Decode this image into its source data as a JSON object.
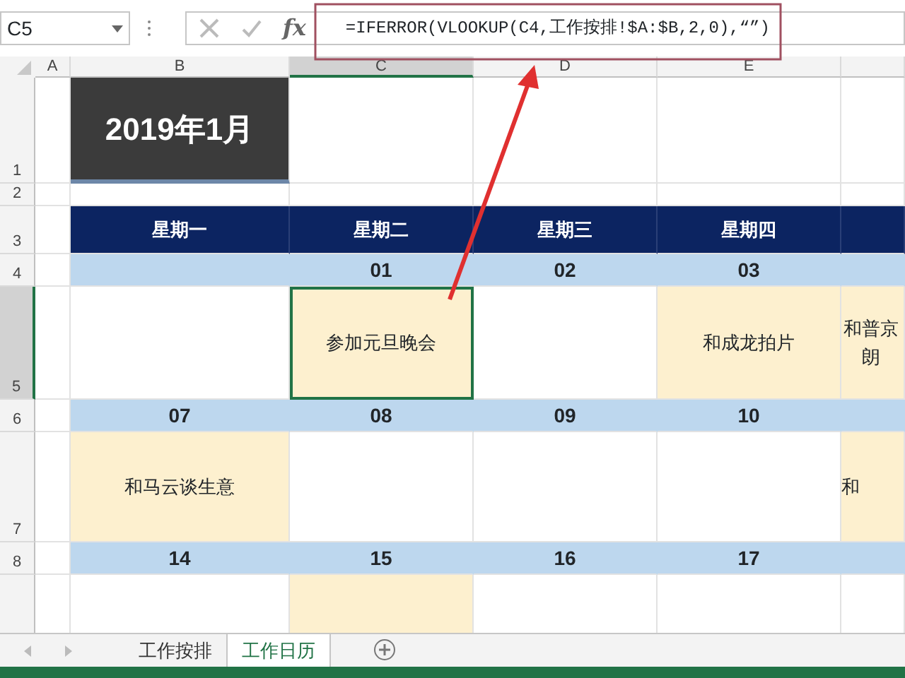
{
  "formula_bar": {
    "name_box": "C5",
    "function_label": "fx",
    "formula": "=IFERROR(VLOOKUP(C4,工作按排!$A:$B,2,0),“”)"
  },
  "columns": [
    {
      "label": "A",
      "selected": false
    },
    {
      "label": "B",
      "selected": false
    },
    {
      "label": "C",
      "selected": true
    },
    {
      "label": "D",
      "selected": false
    },
    {
      "label": "E",
      "selected": false
    }
  ],
  "rows": [
    {
      "label": "1",
      "selected": false
    },
    {
      "label": "2",
      "selected": false
    },
    {
      "label": "3",
      "selected": false
    },
    {
      "label": "4",
      "selected": false
    },
    {
      "label": "5",
      "selected": true
    },
    {
      "label": "6",
      "selected": false
    },
    {
      "label": "7",
      "selected": false
    },
    {
      "label": "8",
      "selected": false
    }
  ],
  "title": "2019年1月",
  "weekdays": [
    "星期一",
    "星期二",
    "星期三",
    "星期四"
  ],
  "weeks": [
    {
      "days": [
        {
          "highlighted": false,
          "selected": false
        },
        {
          "date": "01",
          "event": "参加元旦晚会",
          "highlighted": true,
          "selected": true
        },
        {
          "date": "02",
          "highlighted": false,
          "selected": false
        },
        {
          "date": "03",
          "event": "和成龙拍片",
          "highlighted": true,
          "selected": false
        },
        {
          "event": "和普京朗",
          "highlighted": true,
          "selected": false
        }
      ]
    },
    {
      "days": [
        {
          "date": "07",
          "event": "和马云谈生意",
          "highlighted": true,
          "selected": false
        },
        {
          "date": "08",
          "highlighted": false,
          "selected": false
        },
        {
          "date": "09",
          "highlighted": false,
          "selected": false
        },
        {
          "date": "10",
          "highlighted": false,
          "selected": false
        },
        {
          "event": "和",
          "highlighted": true,
          "selected": false
        }
      ]
    },
    {
      "days": [
        {
          "date": "14",
          "highlighted": false,
          "selected": false
        },
        {
          "date": "15",
          "highlighted": true,
          "selected": false
        },
        {
          "date": "16",
          "highlighted": false,
          "selected": false
        },
        {
          "date": "17",
          "highlighted": false,
          "selected": false
        },
        {
          "highlighted": false,
          "selected": false
        }
      ]
    }
  ],
  "sheet_tabs": [
    {
      "label": "工作按排",
      "selected": false
    },
    {
      "label": "工作日历",
      "selected": true
    }
  ]
}
